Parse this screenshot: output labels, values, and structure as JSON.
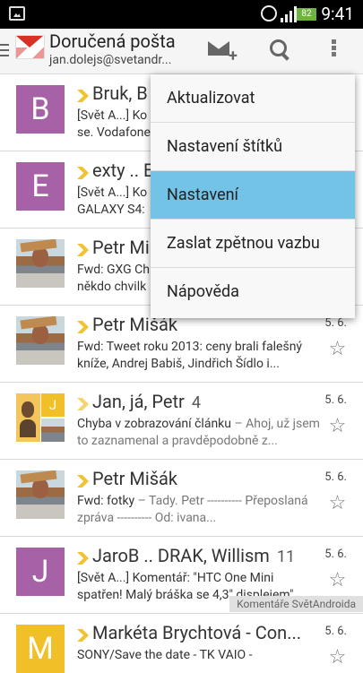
{
  "status_bar": {
    "time": "9:41",
    "battery": "82"
  },
  "action_bar": {
    "title": "Doručená pošta",
    "account": "jan.dolejs@svetandr..."
  },
  "menu": {
    "items": [
      "Aktualizovat",
      "Nastavení štítků",
      "Nastavení",
      "Zaslat zpětnou vazbu",
      "Nápověda"
    ]
  },
  "emails": [
    {
      "avatar_text": "B",
      "avatar_color": "#a761a6",
      "sender": "Bruk, B",
      "snippet": "[Svět A...] Ko",
      "snippet_2": "se. Vodafone",
      "date": "",
      "count": ""
    },
    {
      "avatar_text": "E",
      "avatar_color": "#a761a6",
      "sender": "exty .. E",
      "snippet": "[Svět A...] Ko",
      "snippet_2": "GALAXY S4:",
      "date": "",
      "count": ""
    },
    {
      "avatar_text": "",
      "avatar_color": "",
      "sender": "Petr Mi",
      "snippet": "Fwd: GXG Ch",
      "snippet_2": "někdo chvilk",
      "date": "",
      "count": ""
    },
    {
      "avatar_text": "",
      "avatar_color": "",
      "sender": "Petr Mišák",
      "snippet": "Fwd: Tweet roku 2013: ceny brali falešný",
      "snippet_2": "kníže, Andrej Babiš, Jindřich Šídlo i...",
      "date": "5. 6.",
      "count": ""
    },
    {
      "avatar_text": "J",
      "avatar_color": "#f1bf28",
      "sender": "Jan, já, Petr",
      "snippet": "Chyba v zobrazování článku",
      "snippet_2": "– Ahoj, už jsem to zaznamenal a pravděpodobně z...",
      "date": "5. 6.",
      "count": "4"
    },
    {
      "avatar_text": "",
      "avatar_color": "",
      "sender": "Petr Mišák",
      "snippet": "Fwd: fotky",
      "snippet_2": "– Tady. Petr ---------- Přeposlaná zpráva ---------- Od: ivana...",
      "date": "5. 6.",
      "count": ""
    },
    {
      "avatar_text": "J",
      "avatar_color": "#a761a6",
      "sender": "JaroB .. DRAK, Willism",
      "snippet": "[Svět A...] Komentář: \"HTC One Mini",
      "snippet_2": "spatřen! Malý bráška se 4,3\" displejem\" ...",
      "date": "5. 6.",
      "count": "11",
      "label": "Komentáře SvětAndroida"
    },
    {
      "avatar_text": "M",
      "avatar_color": "#f1bf28",
      "sender": "Markéta Brychtová - Con...",
      "snippet": "SONY/Save the date - TK VAIO -",
      "snippet_2": "",
      "date": "5. 6.",
      "count": ""
    }
  ]
}
